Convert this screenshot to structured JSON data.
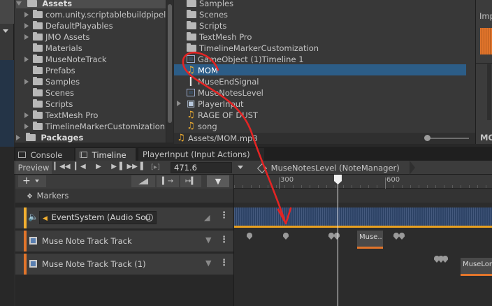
{
  "left_tree": {
    "root": "Assets",
    "items": [
      {
        "label": "com.unity.scriptablebuildpipel",
        "expandable": true
      },
      {
        "label": "DefaultPlayables",
        "expandable": true
      },
      {
        "label": "JMO Assets",
        "expandable": true
      },
      {
        "label": "Materials",
        "expandable": false
      },
      {
        "label": "MuseNoteTrack",
        "expandable": true
      },
      {
        "label": "Prefabs",
        "expandable": false
      },
      {
        "label": "Samples",
        "expandable": true
      },
      {
        "label": "Scenes",
        "expandable": false
      },
      {
        "label": "Scripts",
        "expandable": false
      },
      {
        "label": "TextMesh Pro",
        "expandable": true
      },
      {
        "label": "TimelineMarkerCustomization",
        "expandable": true
      }
    ],
    "packages": "Packages"
  },
  "asset_list": {
    "items": [
      {
        "label": "Samples",
        "icon": "folder-icon"
      },
      {
        "label": "Scenes",
        "icon": "folder-icon"
      },
      {
        "label": "Scripts",
        "icon": "folder-icon"
      },
      {
        "label": "TextMesh Pro",
        "icon": "folder-icon"
      },
      {
        "label": "TimelineMarkerCustomization",
        "icon": "folder-icon"
      },
      {
        "label": "GameObject (1)Timeline 1",
        "icon": "timeline-icon"
      },
      {
        "label": "MOM",
        "icon": "audio-icon"
      },
      {
        "label": "MuseEndSignal",
        "icon": "signal-icon"
      },
      {
        "label": "MuseNotesLevel",
        "icon": "scene-icon"
      },
      {
        "label": "PlayerInput",
        "icon": "input-icon"
      },
      {
        "label": "RAGE OF DUST",
        "icon": "audio-icon"
      },
      {
        "label": "song",
        "icon": "audio-icon"
      }
    ],
    "path": "Assets/MOM.mp3"
  },
  "inspector": {
    "label": "Imp",
    "footer": "MO"
  },
  "tabs": [
    {
      "label": "Console"
    },
    {
      "label": "Timeline"
    },
    {
      "label": "PlayerInput (Input Actions)"
    }
  ],
  "toolbar": {
    "preview": "Preview",
    "frame_value": "471.6",
    "frame_prefix": "[▸]",
    "breadcrumb": "MuseNotesLevel (NoteManager)"
  },
  "ruler": {
    "ticks": [
      "300",
      "600"
    ]
  },
  "tracks": {
    "markers_label": "Markers",
    "audio_label": "EventSystem (Audio Sou",
    "track1_label": "Muse Note Track Track",
    "track2_label": "Muse Note Track Track (1)"
  },
  "clips": {
    "clip1": "Muse..",
    "clip2": "MuseLon"
  },
  "colors": {
    "selection": "#2c5d87",
    "accent_orange": "#e2752b",
    "audio_wave": "#2d4366",
    "annotation_red": "#e32424"
  }
}
